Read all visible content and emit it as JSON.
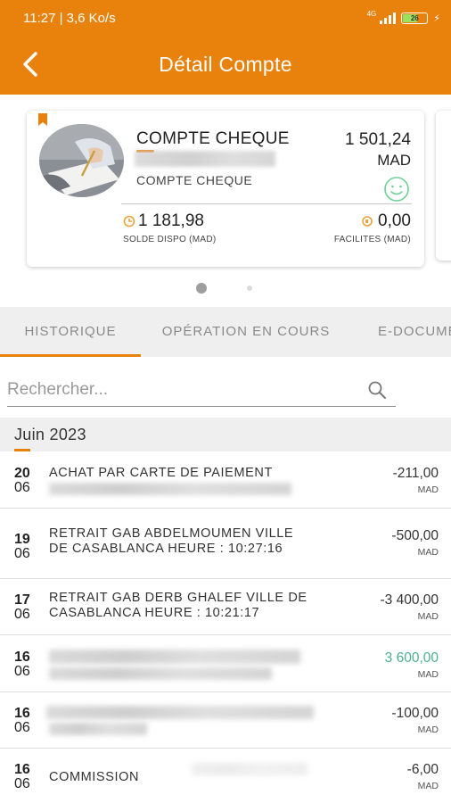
{
  "status_bar": {
    "time": "11:27 | 3,6 Ko/s",
    "network": "4G",
    "battery": "26"
  },
  "header": {
    "title": "Détail Compte",
    "back_icon": "chevron-left-icon"
  },
  "account": {
    "type": "COMPTE CHEQUE",
    "subtype": "COMPTE CHEQUE",
    "balance": "1 501,24",
    "currency": "MAD",
    "available_balance": "1 181,98",
    "available_label": "SOLDE DISPO (MAD)",
    "facilities": "0,00",
    "facilities_label": "FACILITES (MAD)"
  },
  "tabs": [
    {
      "label": "HISTORIQUE",
      "active": true
    },
    {
      "label": "OPÉRATION EN COURS",
      "active": false
    },
    {
      "label": "E-DOCUMENTS",
      "active": false
    }
  ],
  "search": {
    "placeholder": "Rechercher..."
  },
  "month": {
    "label": "Juin 2023"
  },
  "transactions": [
    {
      "day": "20",
      "month": "06",
      "description": "ACHAT PAR CARTE DE PAIEMENT",
      "amount": "-211,00",
      "currency": "MAD",
      "type": "debit"
    },
    {
      "day": "19",
      "month": "06",
      "description": "RETRAIT GAB ABDELMOUMEN VILLE DE CASABLANCA HEURE : 10:27:16",
      "amount": "-500,00",
      "currency": "MAD",
      "type": "debit"
    },
    {
      "day": "17",
      "month": "06",
      "description": "RETRAIT GAB DERB GHALEF VILLE DE CASABLANCA HEURE : 10:21:17",
      "amount": "-3 400,00",
      "currency": "MAD",
      "type": "debit"
    },
    {
      "day": "16",
      "month": "06",
      "description": "",
      "amount": "3 600,00",
      "currency": "MAD",
      "type": "credit"
    },
    {
      "day": "16",
      "month": "06",
      "description": "",
      "amount": "-100,00",
      "currency": "MAD",
      "type": "debit"
    },
    {
      "day": "16",
      "month": "06",
      "description": "COMMISSION",
      "amount": "-6,00",
      "currency": "MAD",
      "type": "debit"
    }
  ],
  "colors": {
    "accent": "#e8820c",
    "credit": "#4caf8f"
  }
}
